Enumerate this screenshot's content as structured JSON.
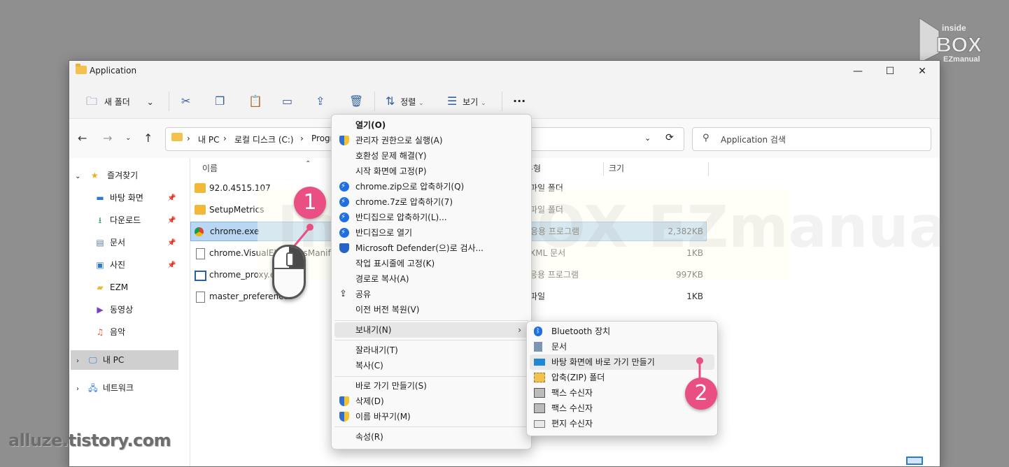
{
  "window": {
    "title": "Application",
    "minimize": "—",
    "maximize": "☐",
    "close": "✕"
  },
  "toolbar": {
    "new_folder": "새 폴더",
    "new_folder_chevron": "⌄",
    "sort": "정렬",
    "view": "보기",
    "more": "···"
  },
  "address": {
    "segments": [
      "내 PC",
      "로컬 디스크 (C:)",
      "Progr"
    ],
    "sep": "›",
    "search_placeholder": "Application 검색"
  },
  "sidebar": {
    "quick_access": "즐겨찾기",
    "items": [
      {
        "label": "바탕 화면",
        "icon": "desktop-icon",
        "pinned": true
      },
      {
        "label": "다운로드",
        "icon": "download-icon",
        "pinned": true
      },
      {
        "label": "문서",
        "icon": "document-icon",
        "pinned": true
      },
      {
        "label": "사진",
        "icon": "pictures-icon",
        "pinned": true
      },
      {
        "label": "EZM",
        "icon": "folder-icon",
        "pinned": false
      },
      {
        "label": "동영상",
        "icon": "video-icon",
        "pinned": false
      },
      {
        "label": "음악",
        "icon": "music-icon",
        "pinned": false
      }
    ],
    "this_pc": "내 PC",
    "network": "네트워크"
  },
  "columns": {
    "name": "이름",
    "type": "유형",
    "size": "크기"
  },
  "files": [
    {
      "name": "92.0.4515.107",
      "type": "파일 폴더",
      "size": "",
      "icon": "folder-icon"
    },
    {
      "name": "SetupMetrics",
      "type": "파일 폴더",
      "size": "",
      "icon": "folder-icon"
    },
    {
      "name": "chrome.exe",
      "type": "응용 프로그램",
      "size": "2,382KB",
      "icon": "chrome-icon"
    },
    {
      "name": "chrome.VisualElementsManifest.x",
      "type": "XML 문서",
      "size": "1KB",
      "icon": "file-icon"
    },
    {
      "name": "chrome_proxy.exe",
      "type": "응용 프로그램",
      "size": "997KB",
      "icon": "app-icon"
    },
    {
      "name": "master_preferences",
      "type": "파일",
      "size": "1KB",
      "icon": "file-icon"
    }
  ],
  "context_menu": [
    {
      "label": "열기(O)",
      "bold": true,
      "icon": ""
    },
    {
      "label": "관리자 권한으로 실행(A)",
      "icon": "shield"
    },
    {
      "label": "호환성 문제 해결(Y)",
      "icon": ""
    },
    {
      "label": "시작 화면에 고정(P)",
      "icon": ""
    },
    {
      "label": "chrome.zip으로 압축하기(Q)",
      "icon": "zip"
    },
    {
      "label": "chrome.7z로 압축하기(7)",
      "icon": "zip"
    },
    {
      "label": "반디집으로 압축하기(L)...",
      "icon": "zip"
    },
    {
      "label": "반디집으로 열기",
      "icon": "zip"
    },
    {
      "label": "Microsoft Defender(으)로 검사...",
      "icon": "defender"
    },
    {
      "label": "작업 표시줄에 고정(K)",
      "icon": ""
    },
    {
      "label": "경로로 복사(A)",
      "icon": ""
    },
    {
      "label": "공유",
      "icon": "share"
    },
    {
      "label": "이전 버전 복원(V)",
      "icon": ""
    },
    {
      "label": "보내기(N)",
      "icon": "",
      "submenu": true
    },
    {
      "label": "잘라내기(T)",
      "icon": ""
    },
    {
      "label": "복사(C)",
      "icon": ""
    },
    {
      "label": "바로 가기 만들기(S)",
      "icon": ""
    },
    {
      "label": "삭제(D)",
      "icon": "shield"
    },
    {
      "label": "이름 바꾸기(M)",
      "icon": "shield"
    },
    {
      "label": "속성(R)",
      "icon": ""
    }
  ],
  "send_to_menu": [
    {
      "label": "Bluetooth 장치",
      "icon": "bluetooth-icon"
    },
    {
      "label": "문서",
      "icon": "document-icon"
    },
    {
      "label": "바탕 화면에 바로 가기 만들기",
      "icon": "desktop-icon"
    },
    {
      "label": "압축(ZIP) 폴더",
      "icon": "zip-folder-icon"
    },
    {
      "label": "팩스 수신자",
      "icon": "fax-icon"
    },
    {
      "label": "팩스 수신자",
      "icon": "fax-icon"
    },
    {
      "label": "편지 수신자",
      "icon": "mail-icon"
    }
  ],
  "annotations": {
    "step1": "1",
    "step2": "2",
    "accent": "#ea4f83"
  },
  "watermark": {
    "center": "Inside BOX EZmanual",
    "logo_top": "inside",
    "logo_mid": "BOX",
    "logo_bottom": "EZmanual",
    "footer": "alluze.tistory.com"
  }
}
